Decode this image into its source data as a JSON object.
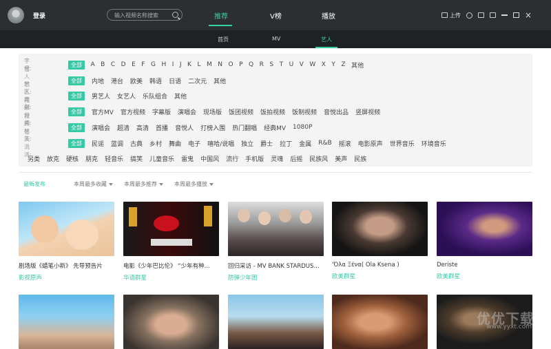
{
  "header": {
    "login_label": "登录",
    "search_placeholder": "输入视频名称搜索",
    "nav": [
      "推荐",
      "V榜",
      "播放"
    ],
    "upload_label": "上传"
  },
  "subnav": [
    "首页",
    "MV",
    "艺人"
  ],
  "filters": {
    "letters": {
      "label": "字母:",
      "options": [
        "全部",
        "A",
        "B",
        "C",
        "D",
        "E",
        "F",
        "G",
        "H",
        "I",
        "J",
        "K",
        "L",
        "M",
        "N",
        "O",
        "P",
        "Q",
        "R",
        "S",
        "T",
        "U",
        "V",
        "W",
        "X",
        "Y",
        "Z",
        "其他"
      ]
    },
    "region": {
      "label": "艺人地区:",
      "options": [
        "全部",
        "内地",
        "港台",
        "欧美",
        "韩语",
        "日语",
        "二次元",
        "其他"
      ]
    },
    "category": {
      "label": "艺人类别:",
      "options": [
        "全部",
        "男艺人",
        "女艺人",
        "乐队组合",
        "其他"
      ]
    },
    "video_type": {
      "label": "视频分类:",
      "options": [
        "全部",
        "官方MV",
        "官方视频",
        "字幕版",
        "演唱会",
        "现场版",
        "饭团视频",
        "饭拍视频",
        "饭制视频",
        "音悦出品",
        "竖屏视频"
      ]
    },
    "video_tag": {
      "label": "视频标签:",
      "options": [
        "全部",
        "演唱会",
        "超清",
        "高清",
        "首播",
        "音悦人",
        "打榜入围",
        "热门翻唱",
        "经典MV",
        "1080P"
      ]
    },
    "genre": {
      "label": "艺人流派:",
      "options": [
        "全部",
        "民谣",
        "蓝调",
        "古典",
        "乡村",
        "舞曲",
        "电子",
        "嘻哈/说唱",
        "独立",
        "爵士",
        "拉丁",
        "金属",
        "R&B",
        "摇滚",
        "电影原声",
        "世界音乐",
        "环境音乐"
      ]
    },
    "genre_more": [
      "另类",
      "放克",
      "硬核",
      "朋克",
      "轻音乐",
      "搞笑",
      "儿童音乐",
      "雷鬼",
      "中国风",
      "流行",
      "手机版",
      "灵魂",
      "后摇",
      "民族风",
      "美声",
      "民族"
    ]
  },
  "sort": [
    "最新发布",
    "本周最多收藏",
    "本周最多推荐",
    "本周最多播放"
  ],
  "cards": [
    {
      "title": "剧场版《蜡笔小新》 先导预告片",
      "artist": "影视原声"
    },
    {
      "title": "电影《少年巴比伦》 “少年有种...",
      "artist": "华语群星"
    },
    {
      "title": "回归采访 - MV BANK STARDUS...",
      "artist": "防弹少年团"
    },
    {
      "title": "'Όλα Ξένα( Ola Ksena )",
      "artist": "欧美群星"
    },
    {
      "title": "Deriste",
      "artist": "欧美群星"
    },
    {
      "title": "",
      "artist": ""
    },
    {
      "title": "",
      "artist": ""
    },
    {
      "title": "",
      "artist": ""
    },
    {
      "title": "",
      "artist": ""
    },
    {
      "title": "",
      "artist": ""
    }
  ],
  "watermark": {
    "main": "优优下载",
    "sub": "www.yyxt.com"
  }
}
